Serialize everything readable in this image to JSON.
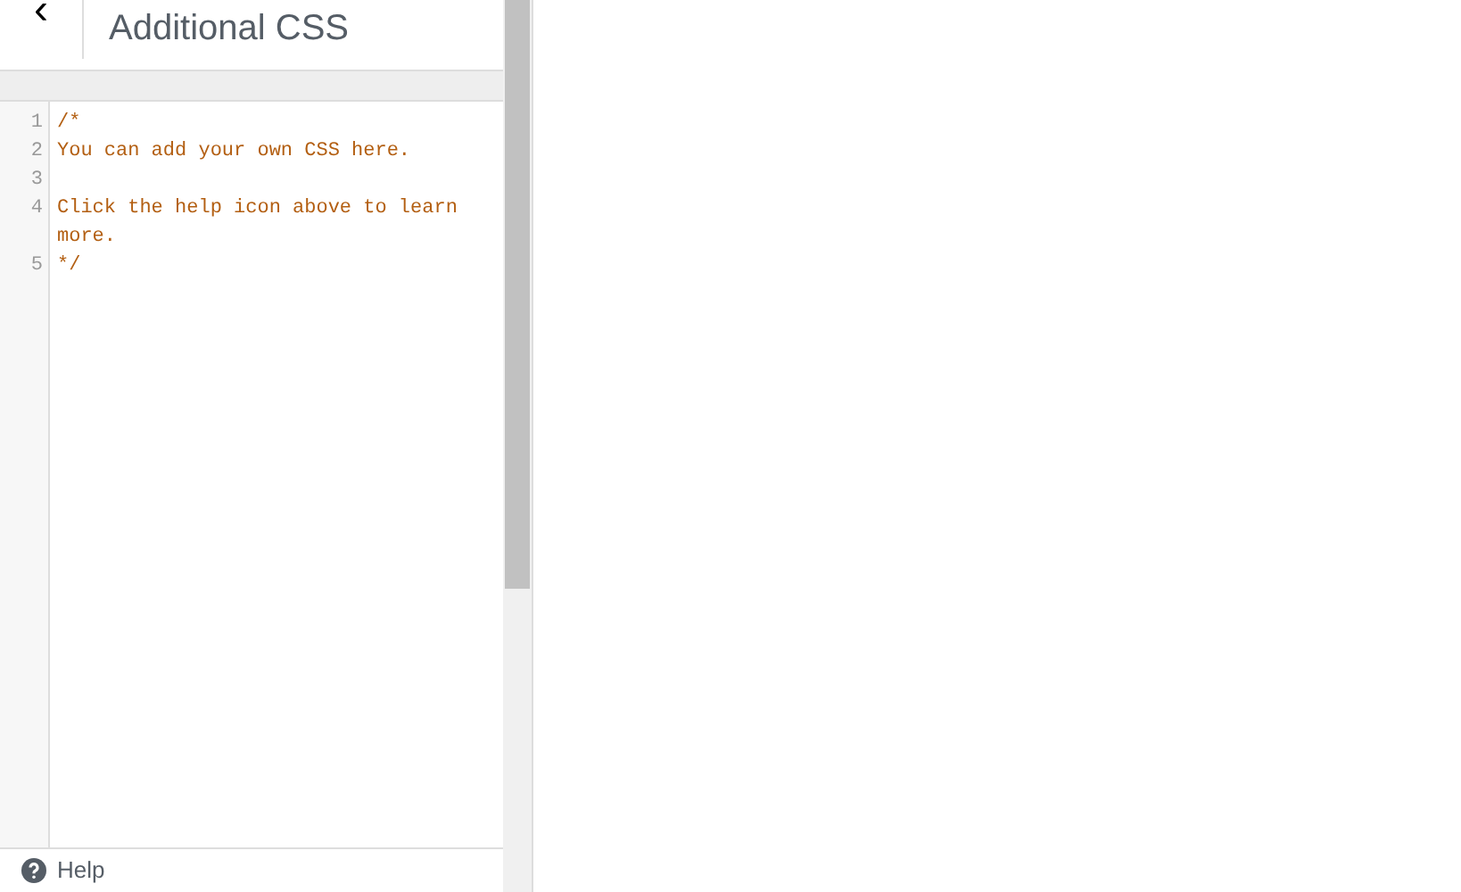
{
  "header": {
    "back_label": "‹",
    "title": "Additional CSS"
  },
  "editor": {
    "lines": [
      {
        "number": "1",
        "text": "/*"
      },
      {
        "number": "2",
        "text": "You can add your own CSS here."
      },
      {
        "number": "3"
      },
      {
        "number": "4",
        "text": "Click the help icon above to learn more."
      },
      {
        "number": "5",
        "text": "*/"
      }
    ]
  },
  "footer": {
    "help_label": "Help"
  }
}
